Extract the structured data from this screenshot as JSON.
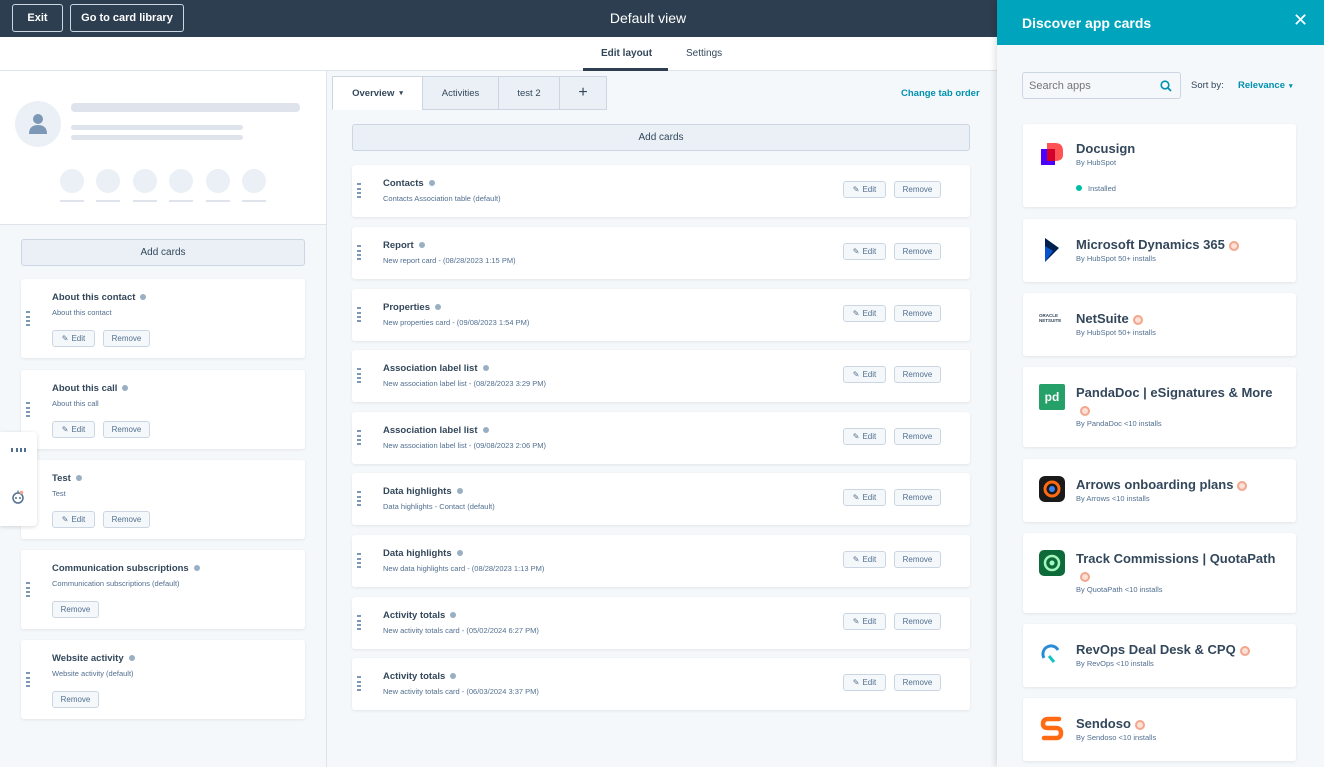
{
  "topbar": {
    "exit_label": "Exit",
    "library_label": "Go to card library",
    "title": "Default view"
  },
  "subtabs": {
    "edit_layout": "Edit layout",
    "settings": "Settings"
  },
  "left": {
    "add_cards": "Add cards",
    "cards": [
      {
        "title": "About this contact",
        "subtitle": "About this contact",
        "edit": "Edit",
        "remove": "Remove"
      },
      {
        "title": "About this call",
        "subtitle": "About this call",
        "edit": "Edit",
        "remove": "Remove"
      },
      {
        "title": "Test",
        "subtitle": "Test",
        "edit": "Edit",
        "remove": "Remove"
      },
      {
        "title": "Communication subscriptions",
        "subtitle": "Communication subscriptions (default)",
        "remove": "Remove"
      },
      {
        "title": "Website activity",
        "subtitle": "Website activity (default)",
        "remove": "Remove"
      }
    ]
  },
  "center": {
    "tabs": [
      "Overview",
      "Activities",
      "test 2",
      "+"
    ],
    "change_tab_order": "Change tab order",
    "add_cards": "Add cards",
    "cards": [
      {
        "title": "Contacts",
        "subtitle": "Contacts Association table (default)"
      },
      {
        "title": "Report",
        "subtitle": "New report card - (08/28/2023 1:15 PM)"
      },
      {
        "title": "Properties",
        "subtitle": "New properties card - (09/08/2023 1:54 PM)"
      },
      {
        "title": "Association label list",
        "subtitle": "New association label list - (08/28/2023 3:29 PM)"
      },
      {
        "title": "Association label list",
        "subtitle": "New association label list - (09/08/2023 2:06 PM)"
      },
      {
        "title": "Data highlights",
        "subtitle": "Data highlights - Contact (default)"
      },
      {
        "title": "Data highlights",
        "subtitle": "New data highlights card - (08/28/2023 1:13 PM)"
      },
      {
        "title": "Activity totals",
        "subtitle": "New activity totals card - (05/02/2024 6:27 PM)"
      },
      {
        "title": "Activity totals",
        "subtitle": "New activity totals card - (06/03/2024 3:37 PM)"
      }
    ],
    "edit_label": "Edit",
    "remove_label": "Remove"
  },
  "sidebar": {
    "title": "Discover app cards",
    "search_placeholder": "Search apps",
    "sort_label": "Sort by:",
    "sort_value": "Relevance",
    "apps": [
      {
        "name": "Docusign",
        "by": "By HubSpot",
        "status": "Installed",
        "color": "#4c00ff"
      },
      {
        "name": "Microsoft Dynamics 365",
        "by": "By HubSpot   50+ installs",
        "color": "#002050"
      },
      {
        "name": "NetSuite",
        "by": "By HubSpot   50+ installs",
        "logo_text": "ORACLE NETSUITE",
        "color": "#33475b"
      },
      {
        "name": "PandaDoc | eSignatures & More",
        "by": "By PandaDoc   <10 installs",
        "logo_text": "pd",
        "color": "#25a069"
      },
      {
        "name": "Arrows onboarding plans",
        "by": "By Arrows   <10 installs",
        "color": "#1a1a1a"
      },
      {
        "name": "Track Commissions | QuotaPath",
        "by": "By QuotaPath   <10 installs",
        "color": "#0f6a3a"
      },
      {
        "name": "RevOps Deal Desk & CPQ",
        "by": "By RevOps   <10 installs",
        "color": "#2a8bd6"
      },
      {
        "name": "Sendoso",
        "by": "By Sendoso   <10 installs",
        "color": "#ff6a13"
      }
    ]
  }
}
